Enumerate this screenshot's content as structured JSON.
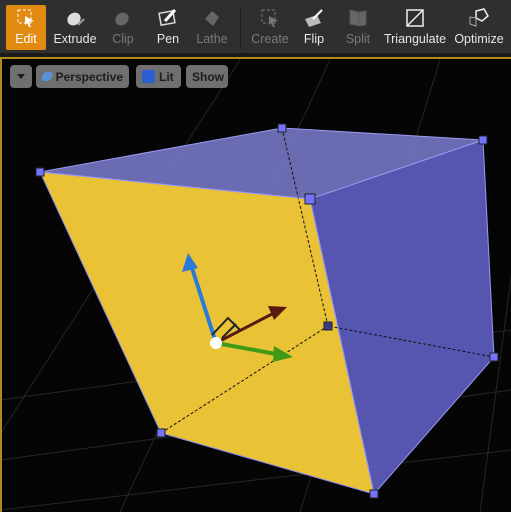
{
  "toolbar": {
    "tools": [
      {
        "label": "Edit",
        "icon": "edit-select-icon",
        "enabled": true,
        "active": true
      },
      {
        "label": "Extrude",
        "icon": "extrude-icon",
        "enabled": true
      },
      {
        "label": "Clip",
        "icon": "clip-icon",
        "enabled": false
      },
      {
        "label": "Pen",
        "icon": "pen-icon",
        "enabled": true
      },
      {
        "label": "Lathe",
        "icon": "lathe-icon",
        "enabled": false
      },
      {
        "label": "Create",
        "icon": "create-icon",
        "enabled": false
      },
      {
        "label": "Flip",
        "icon": "flip-icon",
        "enabled": true
      },
      {
        "label": "Split",
        "icon": "split-icon",
        "enabled": false
      },
      {
        "label": "Triangulate",
        "icon": "triangulate-icon",
        "enabled": true
      },
      {
        "label": "Optimize",
        "icon": "optimize-icon",
        "enabled": true
      }
    ]
  },
  "viewport": {
    "perspective_label": "Perspective",
    "lit_label": "Lit",
    "show_label": "Show",
    "colors": {
      "selected_face": "#e9c236",
      "faces": "#5f5fc4",
      "accent": "#e28b12"
    }
  }
}
